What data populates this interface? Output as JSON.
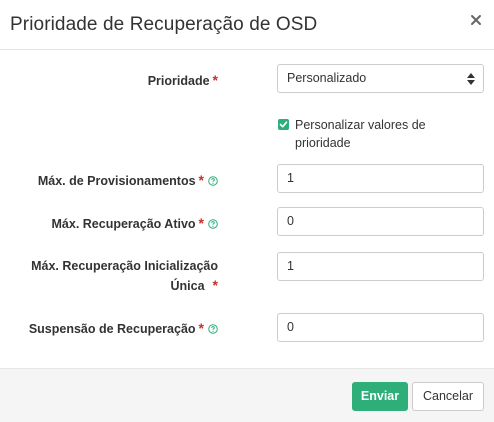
{
  "modal": {
    "title": "Prioridade de Recuperação de OSD",
    "close_icon": "close-icon"
  },
  "form": {
    "priority": {
      "label": "Prioridade",
      "required_mark": "*",
      "value": "Personalizado"
    },
    "customize": {
      "label": "Personalizar valores de prioridade",
      "checked": true
    },
    "max_backfills": {
      "label": "Máx. de Provisionamentos",
      "required_mark": "*",
      "value": "1"
    },
    "max_recovery_active": {
      "label": "Máx. Recuperação Ativo",
      "required_mark": "*",
      "value": "0"
    },
    "max_single_start": {
      "label_line1": "Máx. Recuperação Inicialização",
      "label_line2": "Única",
      "required_mark": "*",
      "value": "1"
    },
    "sleep": {
      "label": "Suspensão de Recuperação",
      "required_mark": "*",
      "value": "0"
    }
  },
  "footer": {
    "submit_label": "Enviar",
    "cancel_label": "Cancelar"
  },
  "colors": {
    "accent": "#2eae79",
    "required": "#c9302c",
    "help_icon": "#2eae79"
  }
}
